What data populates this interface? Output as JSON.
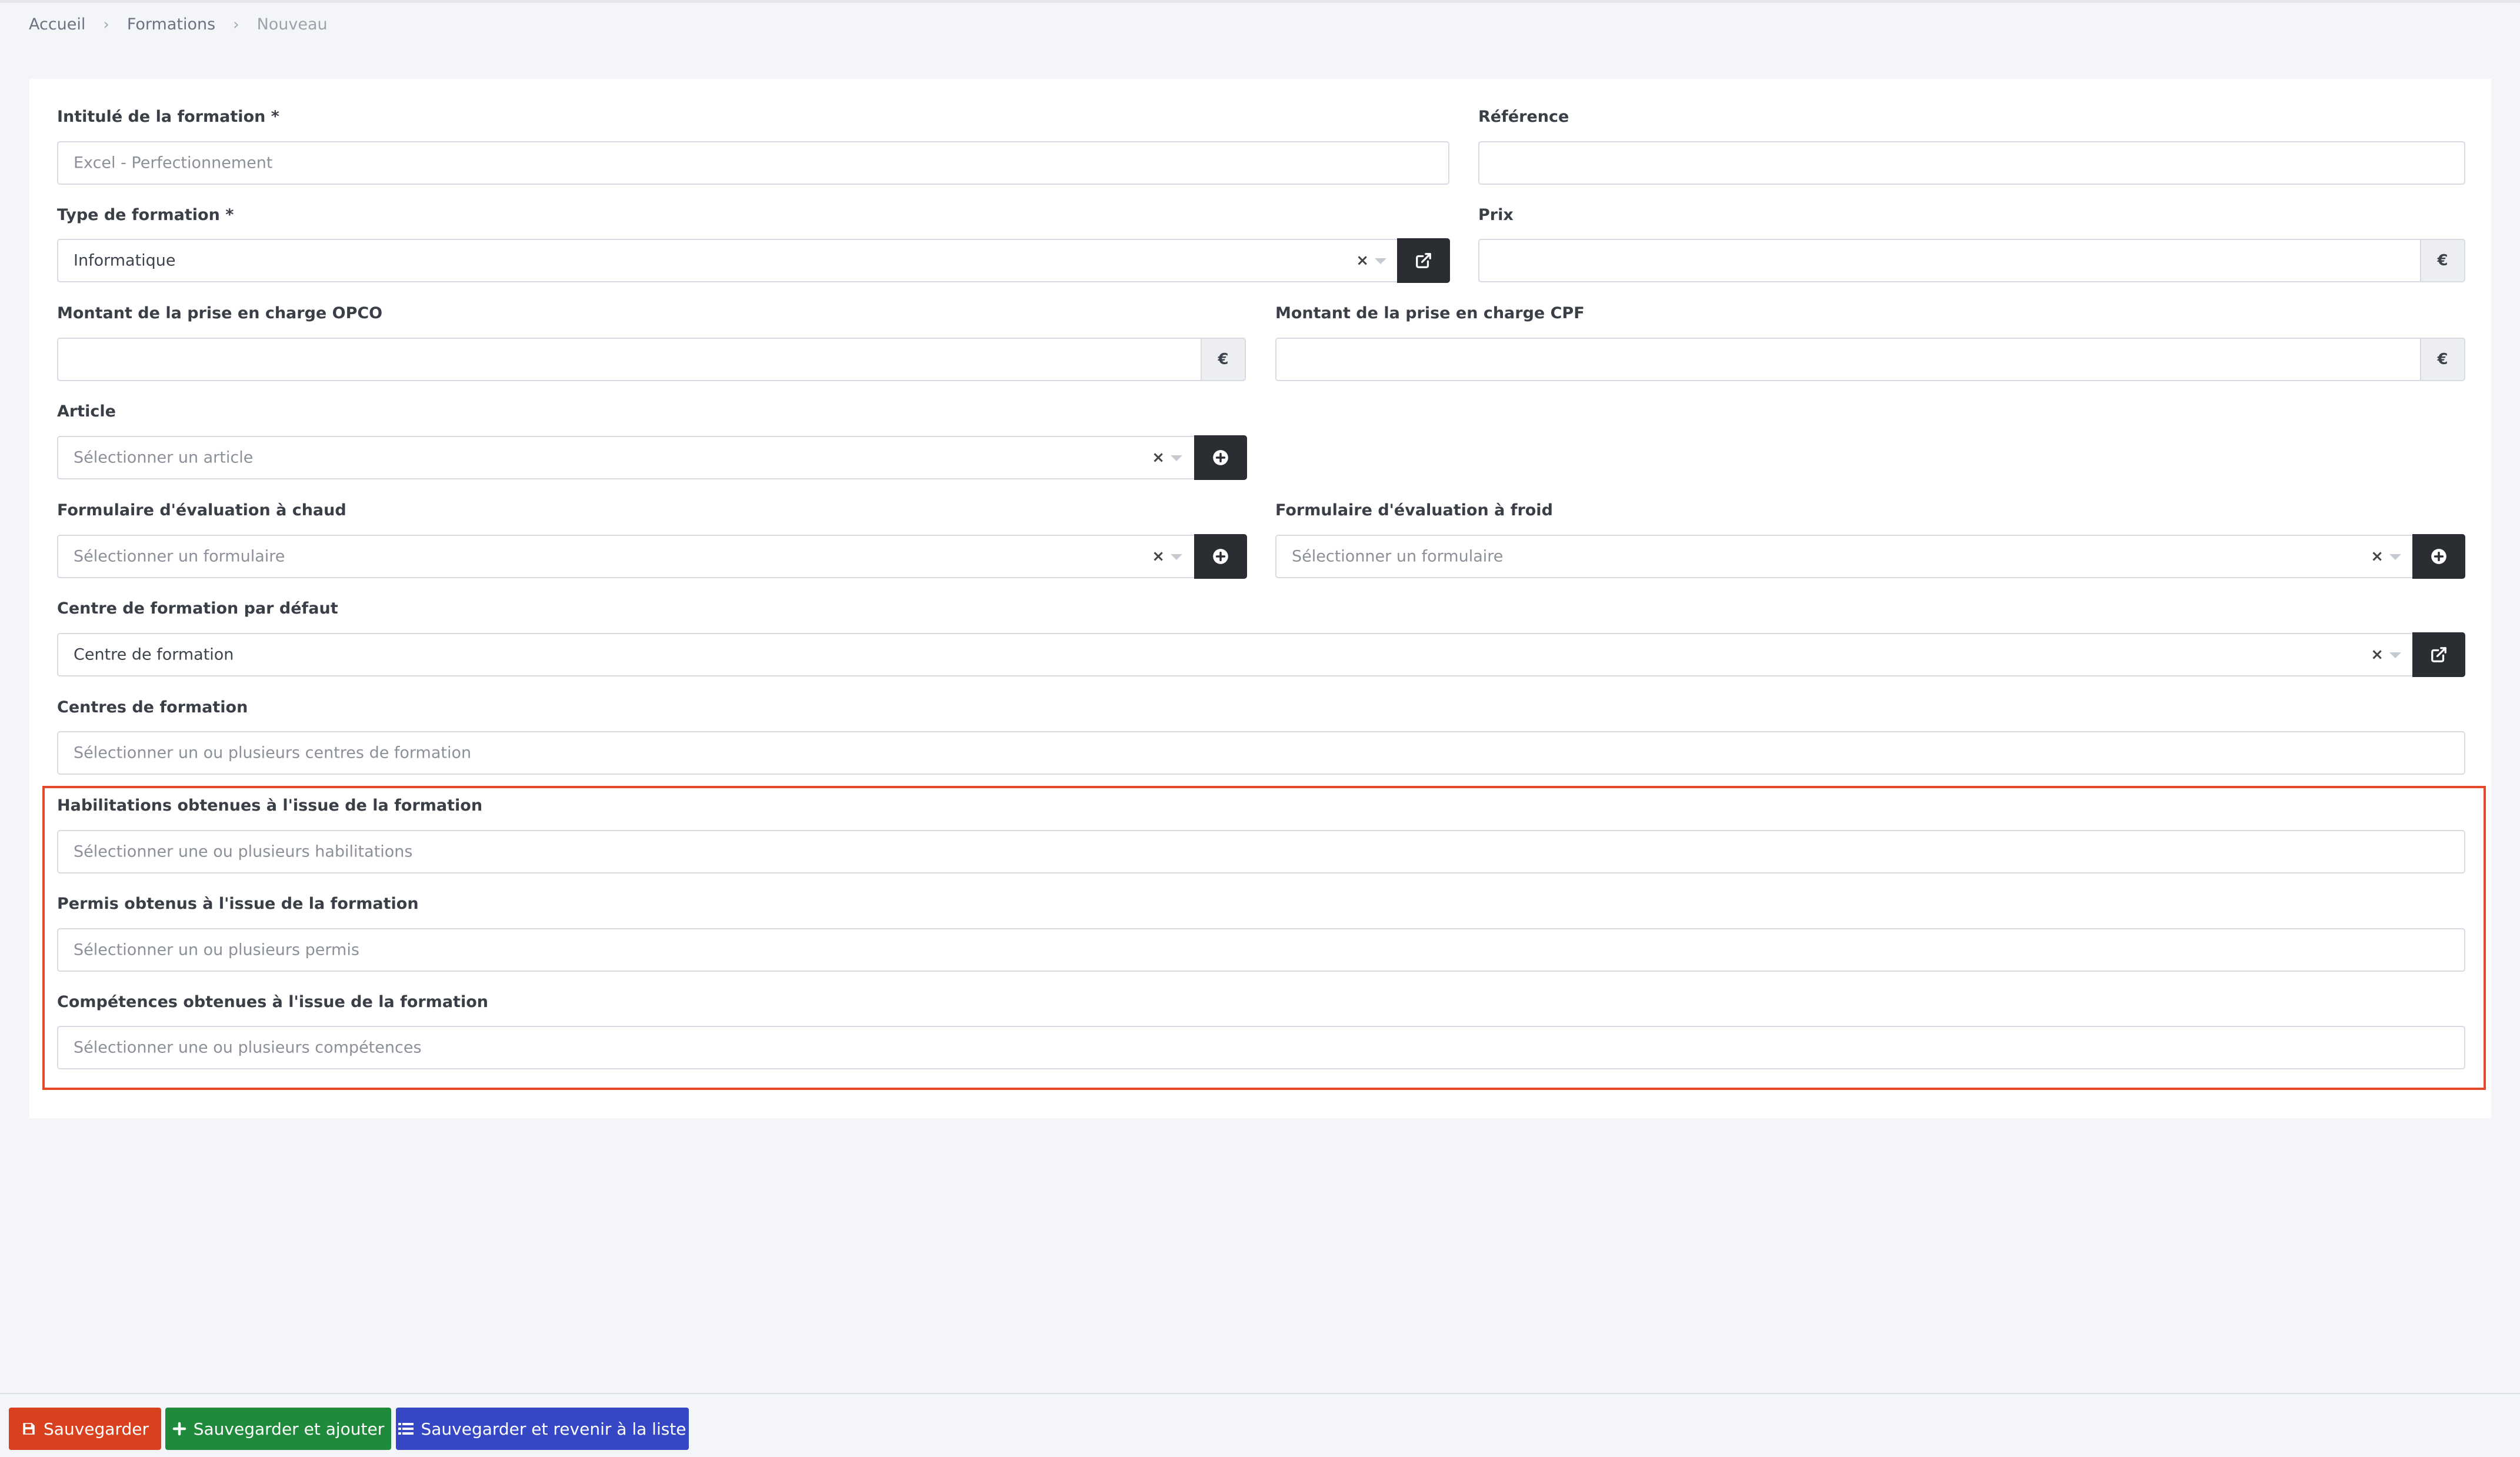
{
  "breadcrumb": {
    "home": "Accueil",
    "section": "Formations",
    "current": "Nouveau"
  },
  "form": {
    "intitule": {
      "label": "Intitulé de la formation *",
      "placeholder": "Excel - Perfectionnement"
    },
    "reference": {
      "label": "Référence",
      "value": ""
    },
    "type": {
      "label": "Type de formation *",
      "value": "Informatique"
    },
    "prix": {
      "label": "Prix",
      "value": "",
      "currency": "€"
    },
    "opco": {
      "label": "Montant de la prise en charge OPCO",
      "value": "",
      "currency": "€"
    },
    "cpf": {
      "label": "Montant de la prise en charge CPF",
      "value": "",
      "currency": "€"
    },
    "article": {
      "label": "Article",
      "placeholder": "Sélectionner un article"
    },
    "eval_chaud": {
      "label": "Formulaire d'évaluation à chaud",
      "placeholder": "Sélectionner un formulaire"
    },
    "eval_froid": {
      "label": "Formulaire d'évaluation à froid",
      "placeholder": "Sélectionner un formulaire"
    },
    "centre_defaut": {
      "label": "Centre de formation par défaut",
      "value": "Centre de formation"
    },
    "centres": {
      "label": "Centres de formation",
      "placeholder": "Sélectionner un ou plusieurs centres de formation"
    },
    "habilitations": {
      "label": "Habilitations obtenues à l'issue de la formation",
      "placeholder": "Sélectionner une ou plusieurs habilitations"
    },
    "permis": {
      "label": "Permis obtenus à l'issue de la formation",
      "placeholder": "Sélectionner un ou plusieurs permis"
    },
    "competences": {
      "label": "Compétences obtenues à l'issue de la formation",
      "placeholder": "Sélectionner une ou plusieurs compétences"
    },
    "clear_symbol": "×"
  },
  "footer": {
    "save": "Sauvegarder",
    "save_add": "Sauvegarder et ajouter",
    "save_list": "Sauvegarder et revenir à la liste"
  },
  "colors": {
    "save": "#d9411e",
    "save_add": "#1f8a3b",
    "save_list": "#3547c4",
    "highlight": "#e24a2a",
    "dark_button": "#2a2d31"
  },
  "icons": {
    "type_action": "external-link-icon",
    "article_action": "plus-circle-icon",
    "eval_chaud_action": "plus-circle-icon",
    "eval_froid_action": "plus-circle-icon",
    "centre_defaut_action": "external-link-icon",
    "save": "floppy-disk-icon",
    "save_add": "plus-icon",
    "save_list": "list-icon"
  }
}
